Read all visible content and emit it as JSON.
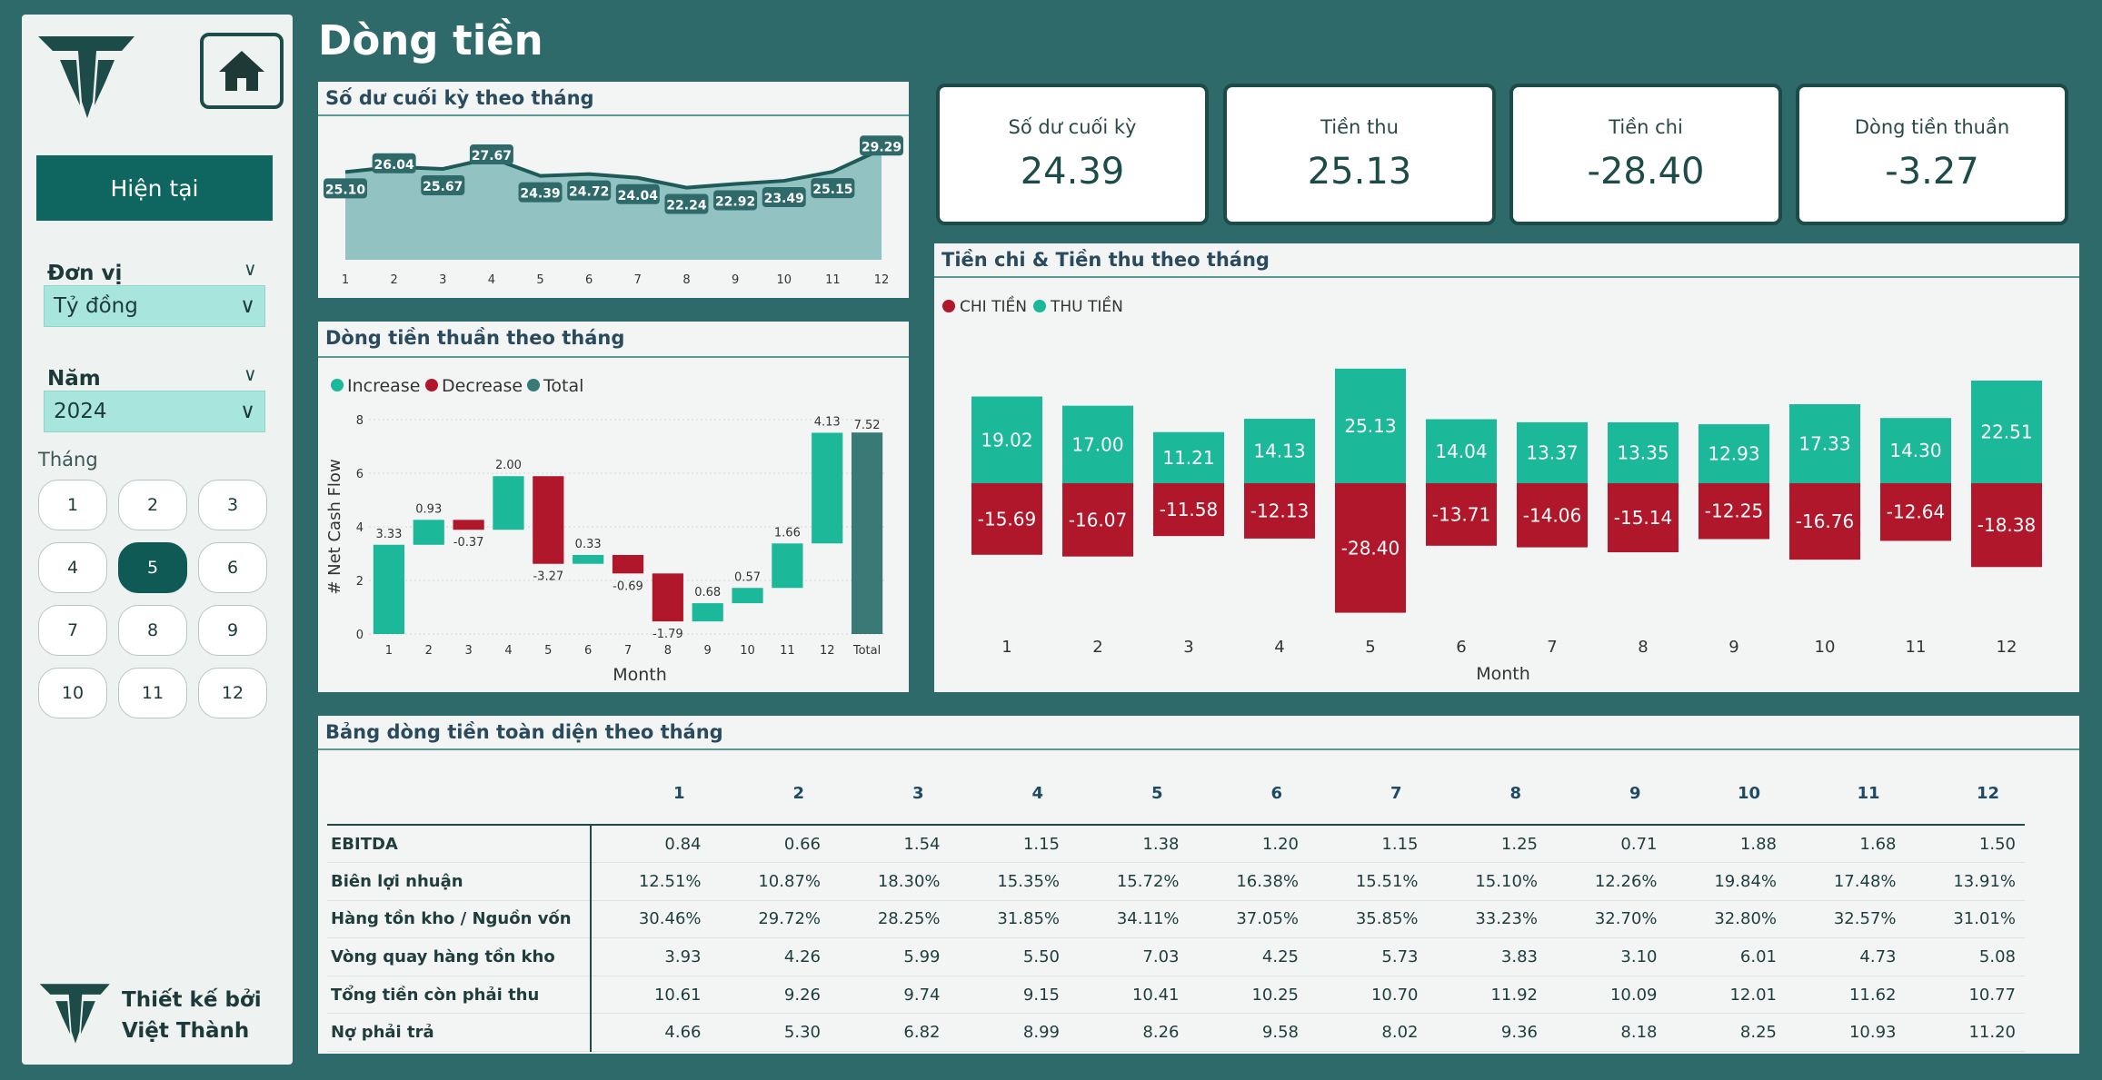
{
  "page_title": "Dòng tiền",
  "sidebar": {
    "current_label": "Hiện tại",
    "unit_label": "Đơn vị",
    "unit_value": "Tỷ đồng",
    "year_label": "Năm",
    "year_value": "2024",
    "month_label": "Tháng",
    "months": [
      "1",
      "2",
      "3",
      "4",
      "5",
      "6",
      "7",
      "8",
      "9",
      "10",
      "11",
      "12"
    ],
    "selected_month": "5",
    "designer_line1": "Thiết kế bởi",
    "designer_line2": "Việt Thành",
    "icons": {
      "home": "home-icon",
      "logo": "brand-logo"
    }
  },
  "kpis": [
    {
      "label": "Số dư cuối kỳ",
      "value": "24.39"
    },
    {
      "label": "Tiền thu",
      "value": "25.13"
    },
    {
      "label": "Tiền chi",
      "value": "-28.40"
    },
    {
      "label": "Dòng tiền thuần",
      "value": "-3.27"
    }
  ],
  "colors": {
    "teal": "#1cb89a",
    "red": "#b0172a",
    "total": "#3a7a76",
    "area": "#93c2c2",
    "line": "#1d5a58"
  },
  "chart_data": [
    {
      "id": "balance",
      "type": "area",
      "title": "Số dư cuối kỳ theo tháng",
      "categories": [
        "1",
        "2",
        "3",
        "4",
        "5",
        "6",
        "7",
        "8",
        "9",
        "10",
        "11",
        "12"
      ],
      "values": [
        25.1,
        26.04,
        25.67,
        27.67,
        24.39,
        24.72,
        24.04,
        22.24,
        22.92,
        23.49,
        25.15,
        29.29
      ],
      "labels": [
        "25.10",
        "26.04",
        "25.67",
        "27.67",
        "24.39",
        "24.72",
        "24.04",
        "22.24",
        "22.92",
        "23.49",
        "25.15",
        "29.29"
      ]
    },
    {
      "id": "net",
      "type": "waterfall",
      "title": "Dòng tiền thuần theo tháng",
      "legend": [
        "Increase",
        "Decrease",
        "Total"
      ],
      "xlabel": "Month",
      "ylabel": "# Net Cash Flow",
      "ylim": [
        0,
        8
      ],
      "yticks": [
        "0",
        "2",
        "4",
        "6",
        "8"
      ],
      "categories": [
        "1",
        "2",
        "3",
        "4",
        "5",
        "6",
        "7",
        "8",
        "9",
        "10",
        "11",
        "12",
        "Total"
      ],
      "deltas": [
        3.33,
        0.93,
        -0.37,
        2.0,
        -3.27,
        0.33,
        -0.69,
        -1.79,
        0.68,
        0.57,
        1.66,
        4.13
      ],
      "labels": [
        "3.33",
        "0.93",
        "-0.37",
        "2.00",
        "-3.27",
        "0.33",
        "-0.69",
        "-1.79",
        "0.68",
        "0.57",
        "1.66",
        "4.13"
      ],
      "total": 7.52,
      "total_label": "7.52"
    },
    {
      "id": "inout",
      "type": "bar",
      "title": "Tiền chi & Tiền thu theo tháng",
      "legend": [
        "CHI TIỀN",
        "THU TIỀN"
      ],
      "xlabel": "Month",
      "categories": [
        "1",
        "2",
        "3",
        "4",
        "5",
        "6",
        "7",
        "8",
        "9",
        "10",
        "11",
        "12"
      ],
      "series": [
        {
          "name": "THU TIỀN",
          "values": [
            19.02,
            17.0,
            11.21,
            14.13,
            25.13,
            14.04,
            13.37,
            13.35,
            12.93,
            17.33,
            14.3,
            22.51
          ],
          "labels": [
            "19.02",
            "17.00",
            "11.21",
            "14.13",
            "25.13",
            "14.04",
            "13.37",
            "13.35",
            "12.93",
            "17.33",
            "14.30",
            "22.51"
          ]
        },
        {
          "name": "CHI TIỀN",
          "values": [
            -15.69,
            -16.07,
            -11.58,
            -12.13,
            -28.4,
            -13.71,
            -14.06,
            -15.14,
            -12.25,
            -16.76,
            -12.64,
            -18.38
          ],
          "labels": [
            "-15.69",
            "-16.07",
            "-11.58",
            "-12.13",
            "-28.40",
            "-13.71",
            "-14.06",
            "-15.14",
            "-12.25",
            "-16.76",
            "-12.64",
            "-18.38"
          ]
        }
      ]
    }
  ],
  "table": {
    "title": "Bảng dòng tiền toàn diện theo tháng",
    "columns": [
      "",
      "1",
      "2",
      "3",
      "4",
      "5",
      "6",
      "7",
      "8",
      "9",
      "10",
      "11",
      "12"
    ],
    "rows": [
      [
        "EBITDA",
        "0.84",
        "0.66",
        "1.54",
        "1.15",
        "1.38",
        "1.20",
        "1.15",
        "1.25",
        "0.71",
        "1.88",
        "1.68",
        "1.50"
      ],
      [
        "Biên lợi nhuận",
        "12.51%",
        "10.87%",
        "18.30%",
        "15.35%",
        "15.72%",
        "16.38%",
        "15.51%",
        "15.10%",
        "12.26%",
        "19.84%",
        "17.48%",
        "13.91%"
      ],
      [
        "Hàng tồn kho / Nguồn vốn",
        "30.46%",
        "29.72%",
        "28.25%",
        "31.85%",
        "34.11%",
        "37.05%",
        "35.85%",
        "33.23%",
        "32.70%",
        "32.80%",
        "32.57%",
        "31.01%"
      ],
      [
        "Vòng quay hàng tồn kho",
        "3.93",
        "4.26",
        "5.99",
        "5.50",
        "7.03",
        "4.25",
        "5.73",
        "3.83",
        "3.10",
        "6.01",
        "4.73",
        "5.08"
      ],
      [
        "Tổng tiền còn phải thu",
        "10.61",
        "9.26",
        "9.74",
        "9.15",
        "10.41",
        "10.25",
        "10.70",
        "11.92",
        "10.09",
        "12.01",
        "11.62",
        "10.77"
      ],
      [
        "Nợ phải trả",
        "4.66",
        "5.30",
        "6.82",
        "8.99",
        "8.26",
        "9.58",
        "8.02",
        "9.36",
        "8.18",
        "8.25",
        "10.93",
        "11.20"
      ]
    ]
  }
}
